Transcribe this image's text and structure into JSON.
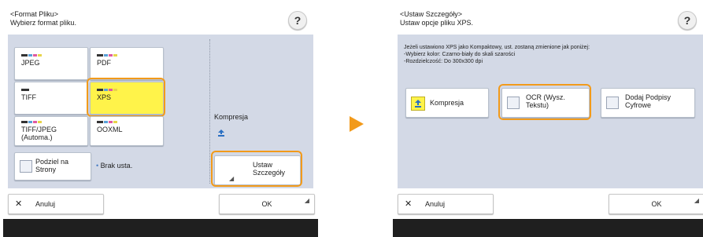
{
  "left": {
    "header": {
      "title": "<Format Pliku>",
      "subtitle": "Wybierz format pliku."
    },
    "formats": [
      {
        "label": "JPEG"
      },
      {
        "label": "PDF"
      },
      {
        "label": "TIFF"
      },
      {
        "label": "XPS"
      },
      {
        "label": "TIFF/JPEG\n(Automa.)"
      },
      {
        "label": "OOXML"
      }
    ],
    "split_button": {
      "label": "Podziel na\nStrony"
    },
    "split_status": "Brak usta.",
    "compression_label": "Kompresja",
    "details_button": {
      "label": "Ustaw\nSzczegóły"
    },
    "footer": {
      "cancel": "Anuluj",
      "ok": "OK"
    }
  },
  "right": {
    "header": {
      "title": "<Ustaw Szczegóły>",
      "subtitle": "Ustaw opcje pliku XPS."
    },
    "info_text": "Jeżeli ustawiono XPS jako Kompaktowy, ust. zostaną zmienione jak poniżej:\n-Wybierz kolor: Czarno-biały do skali szarości\n-Rozdzielczość: Do 300x300 dpi",
    "options": [
      {
        "label": "Kompresja"
      },
      {
        "label": "OCR (Wysz.\nTekstu)"
      },
      {
        "label": "Dodaj Podpisy\nCyfrowe"
      }
    ],
    "footer": {
      "cancel": "Anuluj",
      "ok": "OK"
    }
  },
  "colors": {
    "accent": "#f29a1a",
    "selected": "#fff34a",
    "panel": "#d3d9e6",
    "bottom_bar": "#1f1f1f"
  }
}
